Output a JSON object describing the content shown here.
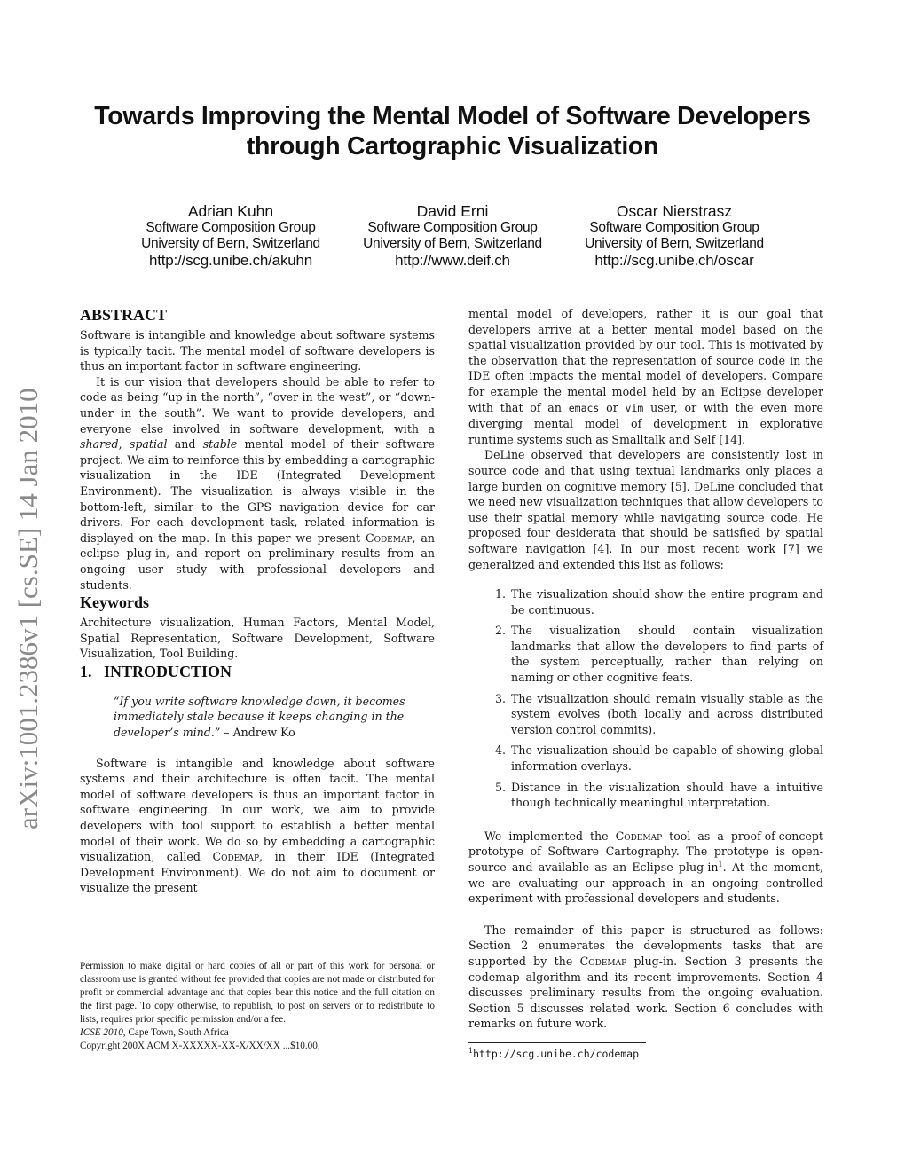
{
  "arxiv_stamp": "arXiv:1001.2386v1  [cs.SE]  14 Jan 2010",
  "title": "Towards Improving the Mental Model of Software Developers through Cartographic Visualization",
  "authors": [
    {
      "name": "Adrian Kuhn",
      "group": "Software Composition Group",
      "university": "University of Bern, Switzerland",
      "url": "http://scg.unibe.ch/akuhn"
    },
    {
      "name": "David Erni",
      "group": "Software Composition Group",
      "university": "University of Bern, Switzerland",
      "url": "http://www.deif.ch"
    },
    {
      "name": "Oscar Nierstrasz",
      "group": "Software Composition Group",
      "university": "University of Bern, Switzerland",
      "url": "http://scg.unibe.ch/oscar"
    }
  ],
  "abstract": {
    "heading": "ABSTRACT",
    "p1": "Software is intangible and knowledge about software systems is typically tacit. The mental model of software developers is thus an important factor in software engineering.",
    "p2_a": "It is our vision that developers should be able to refer to code as being “up in the north”, “over in the west”, or “down-under in the south”. We want to provide developers, and everyone else involved in software development, with a ",
    "p2_em1": "shared",
    "p2_sep1": ", ",
    "p2_em2": "spatial",
    "p2_sep2": " and ",
    "p2_em3": "stable",
    "p2_b": " mental model of their software project. We aim to reinforce this by embedding a cartographic visualization in the IDE (Integrated Development Environment). The visualization is always visible in the bottom-left, similar to the GPS navigation device for car drivers. For each development task, related information is displayed on the map. In this paper we present ",
    "p2_sc": "Codemap",
    "p2_c": ", an eclipse plug-in, and report on preliminary results from an ongoing user study with professional developers and students."
  },
  "keywords": {
    "heading": "Keywords",
    "text": "Architecture visualization, Human Factors, Mental Model, Spatial Representation, Software Development, Software Visualization, Tool Building."
  },
  "introduction": {
    "heading": "1.   INTRODUCTION",
    "quote": "“If you write software knowledge down, it becomes immediately stale because it keeps changing in the developer’s mind.”",
    "quote_attribution": " – Andrew Ko",
    "p1_a": "Software is intangible and knowledge about software systems and their architecture is often tacit. The mental model of software developers is thus an important factor in software engineering. In our work, we aim to provide developers with tool support to establish a better mental model of their work. We do so by embedding a cartographic visualization, called ",
    "p1_sc": "Codemap",
    "p1_b": ", in their IDE (Integrated Development Environment). We do not aim to document or visualize the present mental model of developers, rather it is our goal that developers arrive at a better mental model based on the spatial visualization provided by our tool. This is motivated by the observation that the representation of source code in the IDE often impacts the mental model of developers. Compare for example the mental model held by an Eclipse developer with that of an ",
    "p1_tt1": "emacs",
    "p1_or": " or ",
    "p1_tt2": "vim",
    "p1_c": " user, or with the even more diverging mental model of development in explorative runtime systems such as Smalltalk and Self [14].",
    "p2": "DeLine observed that developers are consistently lost in source code and that using textual landmarks only places a large burden on cognitive memory [5]. DeLine concluded that we need new visualization techniques that allow developers to use their spatial memory while navigating source code. He proposed four desiderata that should be satisfied by spatial software navigation [4]. In our most recent work [7] we generalized and extended this list as follows:",
    "desiderata": [
      "The visualization should show the entire program and be continuous.",
      "The visualization should contain visualization landmarks that allow the developers to find parts of the system perceptually, rather than relying on naming or other cognitive feats.",
      "The visualization should remain visually stable as the system evolves (both locally and across distributed version control commits).",
      "The visualization should be capable of showing global information overlays.",
      "Distance in the visualization should have a intuitive though technically meaningful interpretation."
    ],
    "p3_a": "We implemented the ",
    "p3_sc": "Codemap",
    "p3_b": " tool as a proof-of-concept prototype of Software Cartography. The prototype is open-source and available as an Eclipse plug-in",
    "p3_sup": "1",
    "p3_c": ". At the moment, we are evaluating our approach in an ongoing controlled experiment with professional developers and students.",
    "p4_a": "The remainder of this paper is structured as follows: Section 2 enumerates the developments tasks that are supported by the ",
    "p4_sc": "Codemap",
    "p4_b": " plug-in. Section 3 presents the codemap algorithm and its recent improvements. Section 4 discusses preliminary results from the ongoing evaluation. Section 5 discusses related work. Section 6 concludes with remarks on future work."
  },
  "footnote": {
    "mark": "1",
    "url": "http://scg.unibe.ch/codemap"
  },
  "permission": {
    "text": "Permission to make digital or hard copies of all or part of this work for personal or classroom use is granted without fee provided that copies are not made or distributed for profit or commercial advantage and that copies bear this notice and the full citation on the first page. To copy otherwise, to republish, to post on servers or to redistribute to lists, requires prior specific permission and/or a fee.",
    "venue_name": "ICSE 2010,",
    "venue_place": " Cape Town, South Africa",
    "copyright": "Copyright 200X ACM X-XXXXX-XX-X/XX/XX ...$10.00."
  }
}
